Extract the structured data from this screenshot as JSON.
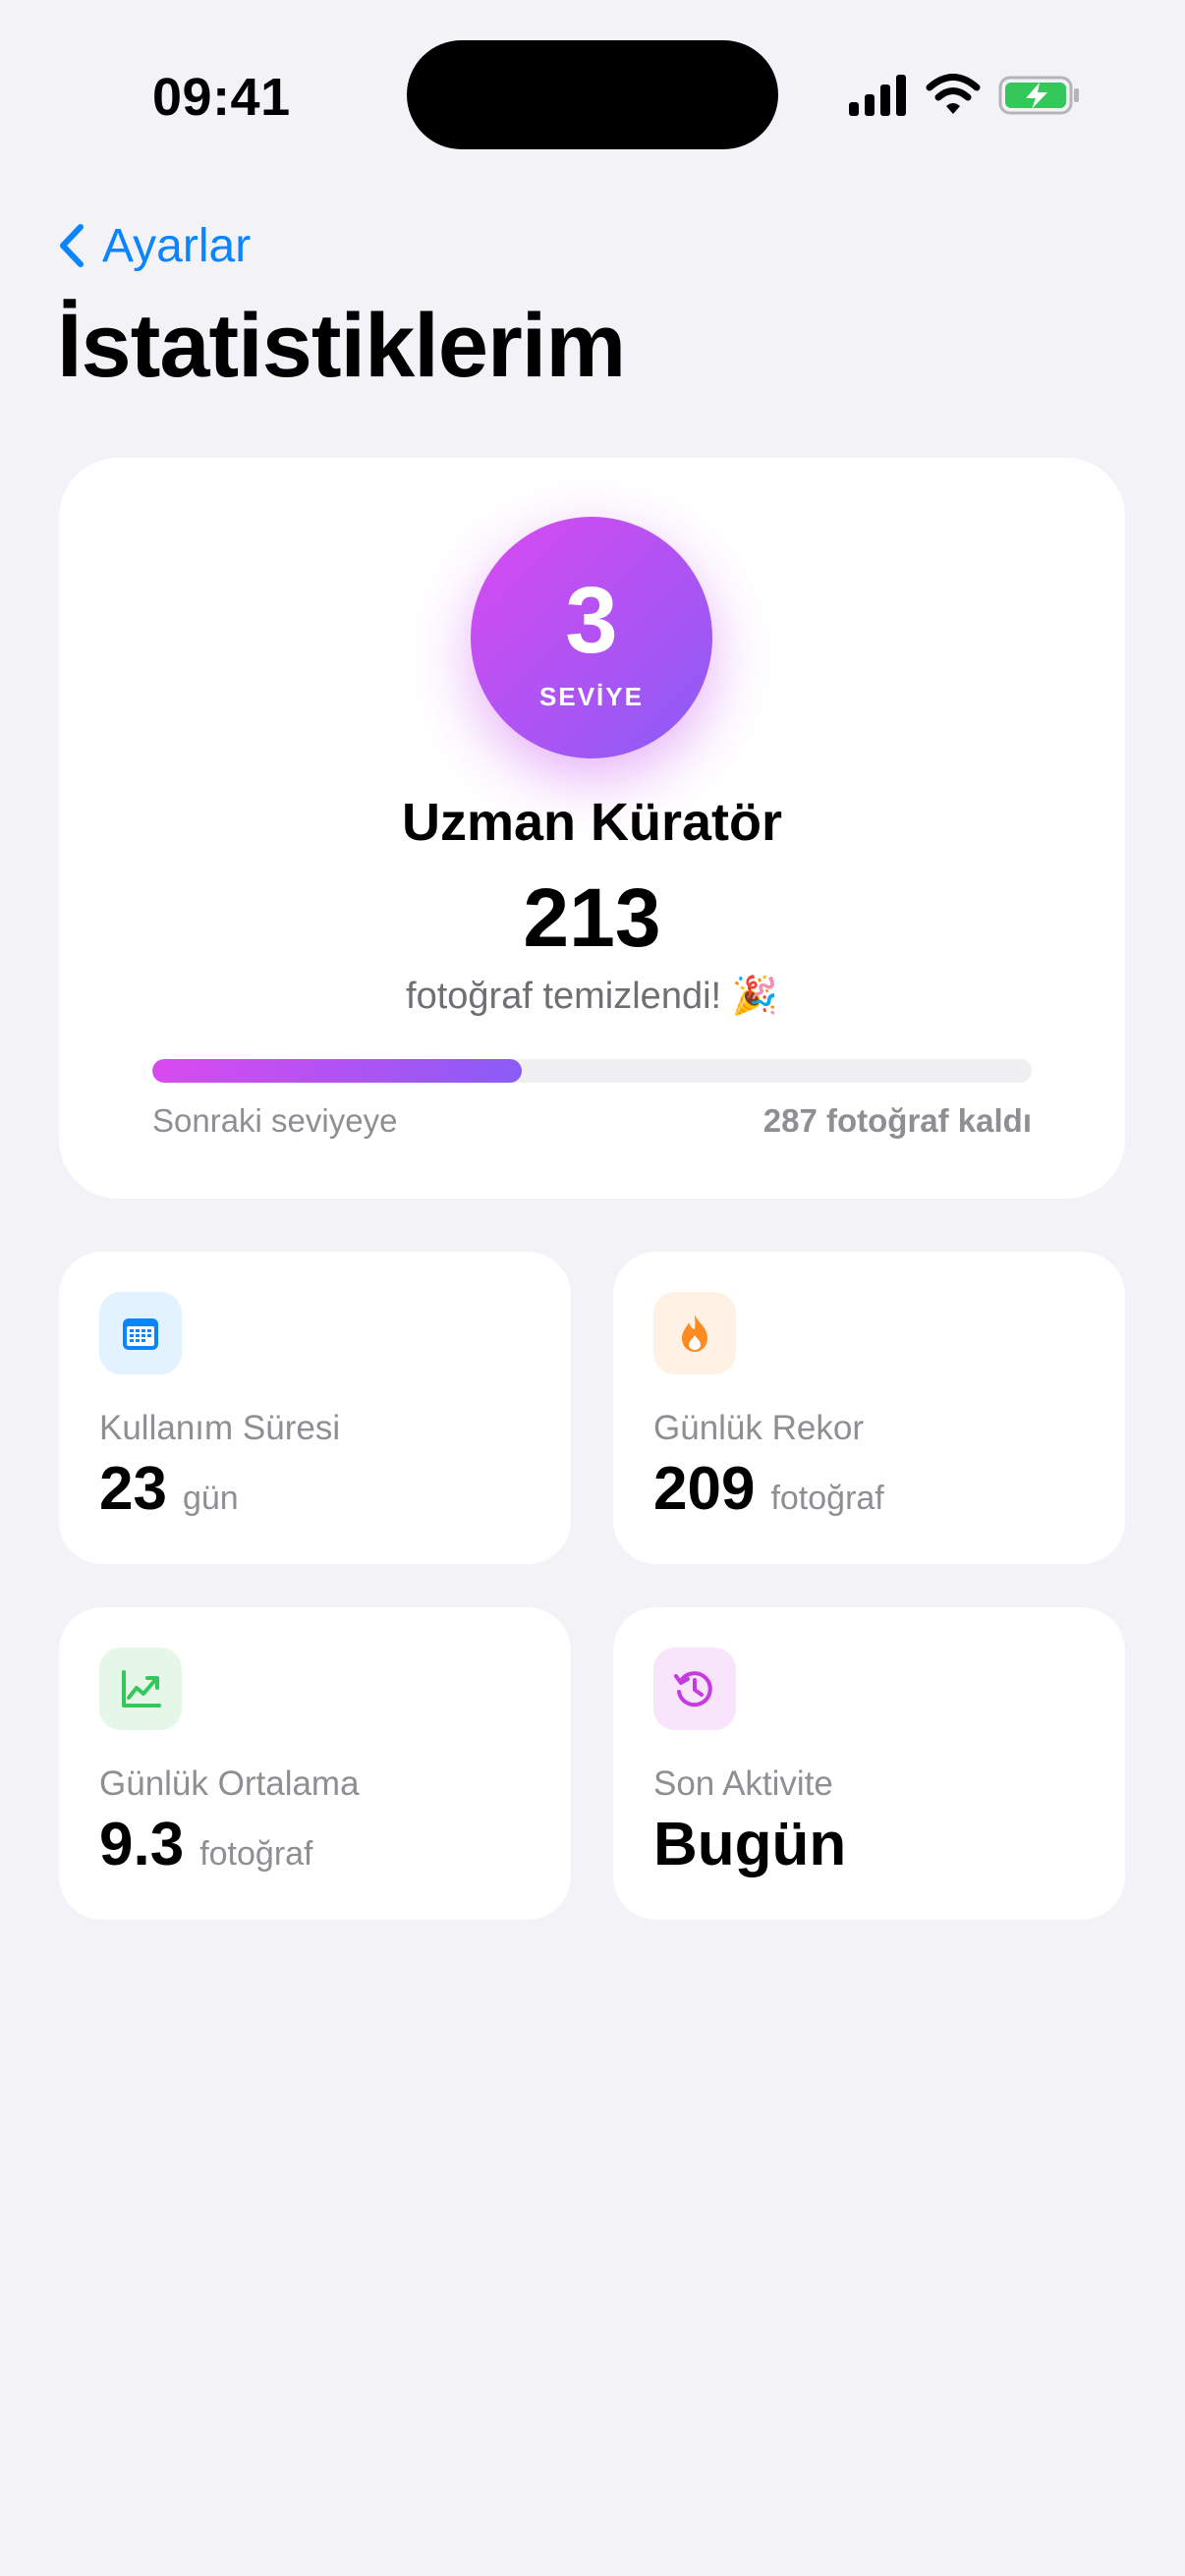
{
  "status_bar": {
    "time": "09:41"
  },
  "nav": {
    "back_label": "Ayarlar",
    "title": "İstatistiklerim"
  },
  "level_card": {
    "level": "3",
    "level_label": "SEVİYE",
    "rank": "Uzman Küratör",
    "count": "213",
    "cleaned_text": "fotoğraf temizlendi! 🎉",
    "progress_fraction": 0.42,
    "progress_left": "Sonraki seviyeye",
    "progress_right": "287 fotoğraf kaldı"
  },
  "stats": [
    {
      "icon": "calendar-icon",
      "label": "Kullanım Süresi",
      "value": "23",
      "unit": "gün",
      "icon_bg": "#e3f2ff",
      "icon_color": "#0a84ff"
    },
    {
      "icon": "flame-icon",
      "label": "Günlük Rekor",
      "value": "209",
      "unit": "fotoğraf",
      "icon_bg": "#fff1e3",
      "icon_color": "#ff8a1f"
    },
    {
      "icon": "chart-trend-icon",
      "label": "Günlük Ortalama",
      "value": "9.3",
      "unit": "fotoğraf",
      "icon_bg": "#e4f7e8",
      "icon_color": "#34c759"
    },
    {
      "icon": "history-icon",
      "label": "Son Aktivite",
      "value": "Bugün",
      "unit": "",
      "icon_bg": "#f8e4fb",
      "icon_color": "#c43be0"
    }
  ],
  "colors": {
    "accent": "#0a84ff",
    "gradient_start": "#d94af0",
    "gradient_end": "#8a5cf6",
    "background": "#f2f2f7"
  }
}
